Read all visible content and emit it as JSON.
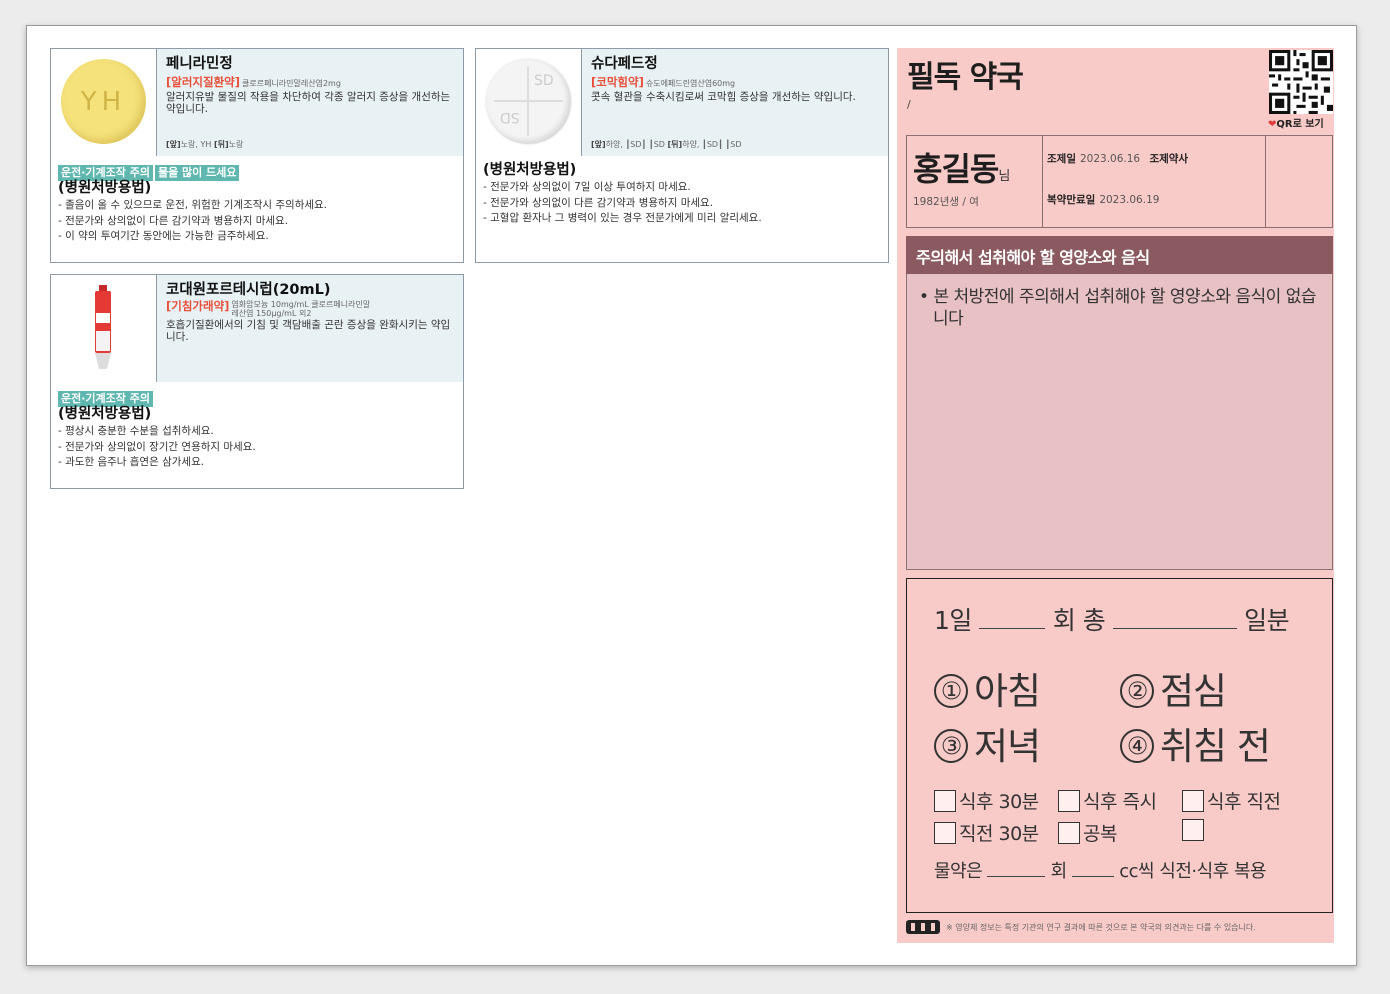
{
  "drugs": [
    {
      "name": "페니라민정",
      "category": "[알러지질환약]",
      "ingredient": "클로르페니라민말레산염2mg",
      "description": "알러지유발 물질의 작용을 차단하여 각종 알러지 증상을 개선하는 약입니다.",
      "appearance": {
        "front_label": "[앞]",
        "front": "노랑, YH",
        "back_label": "[뒤]",
        "back": "노랑"
      },
      "pill_marking": "YH",
      "badges": [
        "운전·기계조작 주의",
        "물을 많이 드세요"
      ],
      "directions_title": "(병원처방용법)",
      "directions": [
        "졸음이 올 수 있으므로 운전, 위험한 기계조작시 주의하세요.",
        "전문가와 상의없이 다른 감기약과 병용하지 마세요.",
        "이 약의 투여기간 동안에는 가능한 금주하세요."
      ]
    },
    {
      "name": "슈다페드정",
      "category": "[코막힘약]",
      "ingredient": "슈도에페드린염산염60mg",
      "description": "콧속 혈관을 수축시킴로써 코막힘 증상을 개선하는 약입니다.",
      "appearance": {
        "front_label": "[앞]",
        "front": "하양, ┃SD┃ ┃SD",
        "back_label": "[뒤]",
        "back": "하양, ┃SD┃ ┃SD"
      },
      "pill_marking": "SD",
      "badges": [],
      "directions_title": "(병원처방용법)",
      "directions": [
        "전문가와 상의없이 7일 이상 투여하지 마세요.",
        "전문가와 상의없이 다른 감기약과 병용하지 마세요.",
        "고혈압 환자나 그 병력이 있는 경우 전문가에게 미리 알리세요."
      ]
    },
    {
      "name": "코대원포르테시럽(20mL)",
      "category": "[기침가래약]",
      "ingredient": "염화암모늄 10mg/mL 클로르페니라민말레산염 150μg/mL 외2",
      "description": "호흡기질환에서의 기침 및 객담배출 곤란 증상을 완화시키는 약입니다.",
      "badges": [
        "운전·기계조작 주의"
      ],
      "directions_title": "(병원처방용법)",
      "directions": [
        "평상시 충분한 수분을 섭취하세요.",
        "전문가와 상의없이 장기간 연용하지 마세요.",
        "과도한 음주나 흡연은 삼가세요."
      ]
    }
  ],
  "pharmacy": {
    "name": "필독 약국",
    "sub": "/",
    "qr_label": "QR로 보기"
  },
  "patient": {
    "name": "홍길동",
    "honorific": "님",
    "info": "1982년생 / 여",
    "dispense_label": "조제일",
    "dispense_date": "2023.06.16",
    "pharmacist_label": "조제약사",
    "end_label": "복약만료일",
    "end_date": "2023.06.19"
  },
  "nutrition": {
    "title": "주의해서 섭취해야 할 영양소와 음식",
    "text": "본 처방전에 주의해서 섭취해야 할 영양소와 음식이 없습니다"
  },
  "dosage": {
    "day_label": "1일",
    "times_label": "회 총",
    "days_label": "일분",
    "times": [
      {
        "num": "①",
        "label": "아침"
      },
      {
        "num": "②",
        "label": "점심"
      },
      {
        "num": "③",
        "label": "저녁"
      },
      {
        "num": "④",
        "label": "취침 전"
      }
    ],
    "checks": [
      "식후 30분",
      "식후 즉시",
      "식후 직전",
      "직전 30분",
      "공복",
      ""
    ],
    "water_prefix": "물약은",
    "water_mid": "회",
    "water_suffix": "cc씩 식전·식후 복용"
  },
  "footer": {
    "text": "※ 영양제 정보는 특정 기관의 연구 결과에 따른 것으로 본 약국의 의견과는 다를 수 있습니다."
  },
  "colors": {
    "panel": "#f9cbc8",
    "header": "#8b5a60",
    "badge": "#5fb7b0",
    "category": "#e8503a"
  }
}
